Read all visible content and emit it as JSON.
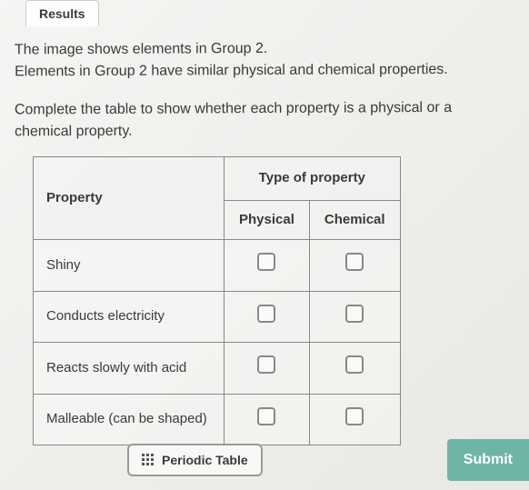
{
  "tab": {
    "label": "Results"
  },
  "instructions": {
    "line1": "The image shows elements in Group 2.",
    "line2": "Elements in Group 2 have similar physical and chemical properties.",
    "line3": "Complete the table to show whether each property is a physical or a chemical property."
  },
  "table": {
    "main_header": "Type of property",
    "property_header": "Property",
    "col1": "Physical",
    "col2": "Chemical",
    "rows": [
      {
        "label": "Shiny"
      },
      {
        "label": "Conducts electricity"
      },
      {
        "label": "Reacts slowly with acid"
      },
      {
        "label": "Malleable (can be shaped)"
      }
    ]
  },
  "buttons": {
    "periodic": "Periodic Table",
    "submit": "Submit"
  }
}
